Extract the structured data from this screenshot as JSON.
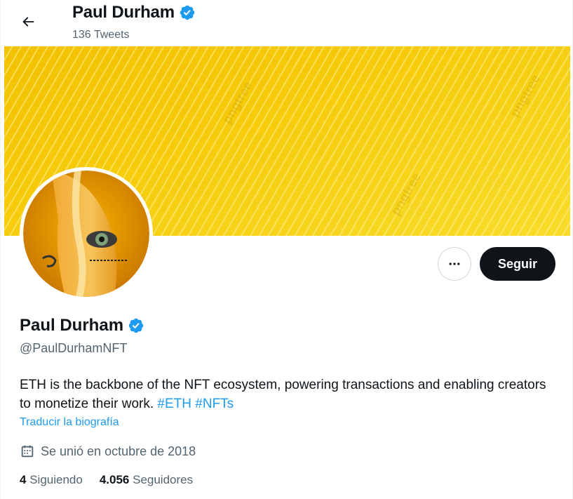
{
  "header": {
    "title": "Paul Durham",
    "tweet_count": "136 Tweets"
  },
  "banner": {
    "watermark": "pngtree"
  },
  "actions": {
    "more_label": "•••",
    "follow_label": "Seguir"
  },
  "profile": {
    "name": "Paul Durham",
    "handle": "@PaulDurhamNFT",
    "bio_text": "ETH is the backbone of the NFT ecosystem, powering transactions and enabling creators to monetize their work. ",
    "bio_hashtags": [
      "#ETH",
      "#NFTs"
    ],
    "translate_label": "Traducir la biografía",
    "joined": "Se unió en octubre de 2018",
    "following_count": "4",
    "following_label": "Siguiendo",
    "followers_count": "4.056",
    "followers_label": "Seguidores"
  },
  "colors": {
    "accent": "#1d9bf0",
    "verified": "#1d9bf0",
    "banner_yellow": "#f6cc0d",
    "button_dark": "#0f1419"
  },
  "icons": {
    "back": "arrow-left-icon",
    "verified": "verified-badge-icon",
    "more": "more-dots-icon",
    "calendar": "calendar-icon"
  }
}
